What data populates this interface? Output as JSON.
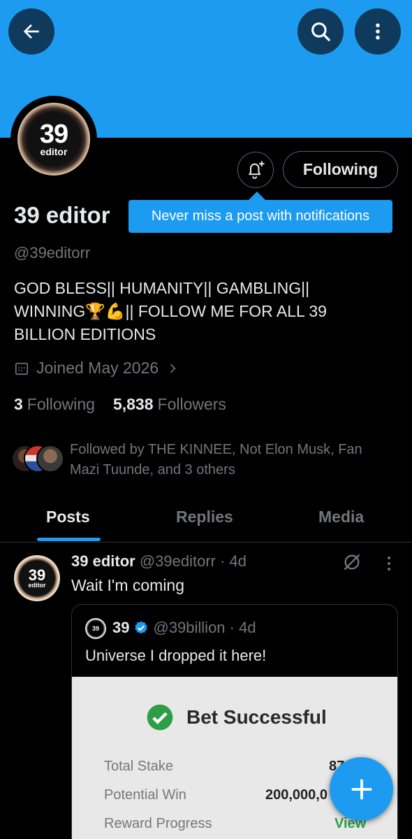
{
  "header": {
    "back_icon": "arrow-left-icon",
    "search_icon": "search-icon",
    "more_icon": "more-vertical-icon",
    "banner_color": "#1d9bf0"
  },
  "profile": {
    "avatar_number": "39",
    "avatar_text": "editor",
    "display_name": "39 editor",
    "handle": "@39editorr",
    "bio": "GOD BLESS|| HUMANITY|| GAMBLING|| WINNING🏆💪|| FOLLOW ME FOR ALL 39 BILLION EDITIONS",
    "joined": "Joined May 2026",
    "following_count": "3",
    "following_label": "Following",
    "followers_count": "5,838",
    "followers_label": "Followers",
    "followed_by": "Followed by THE KINNEE, Not Elon Musk, Fan Mazi Tuunde, and 3 others"
  },
  "actions": {
    "notify_icon": "bell-plus-icon",
    "following_button": "Following"
  },
  "tooltip": {
    "text": "Never miss a post with notifications"
  },
  "tabs": [
    {
      "label": "Posts",
      "active": true
    },
    {
      "label": "Replies",
      "active": false
    },
    {
      "label": "Media",
      "active": false
    }
  ],
  "post": {
    "author": "39 editor",
    "handle_time": "@39editorr · 4d",
    "text": "Wait I'm coming",
    "avatar_number": "39",
    "avatar_text": "editor",
    "quote": {
      "avatar_text": "39",
      "author": "39",
      "verified_icon": "verified-badge-icon",
      "handle_time": "@39billion · 4d",
      "text": "Universe I dropped it here!",
      "media": {
        "title": "Bet Successful",
        "rows": [
          {
            "label": "Total Stake",
            "value": "87"
          },
          {
            "label": "Potential Win",
            "value": "200,000,0"
          },
          {
            "label": "Reward Progress",
            "value": "View"
          }
        ]
      }
    }
  },
  "fab": {
    "icon": "plus-icon"
  },
  "colors": {
    "accent": "#1d9bf0",
    "muted": "#71767b",
    "text": "#e7e9ea",
    "success": "#2e9e45"
  }
}
